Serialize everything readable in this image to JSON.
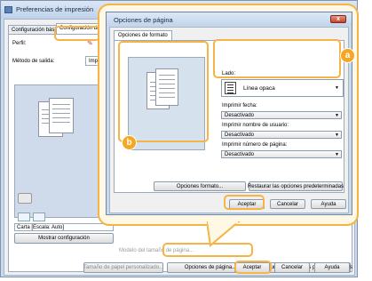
{
  "outer_window": {
    "title": "Preferencias de impresión",
    "tabs": [
      "Configuración básica",
      "Configuración de p"
    ],
    "profile_label": "Perfil:",
    "output_method_label": "Método de salida:",
    "output_method_value": "Imp",
    "paper_label": "Carta [Escala: Auto]",
    "show_config_button": "Mostrar configuración",
    "faded_row_left": "Tamaño de papel personalizado...",
    "faded_row_mid": "Modelo del tamaño de página...",
    "page_options_button": "Opciones de página...",
    "restore_button": "Restaurar las opciones predeterminadas",
    "ok_button": "Aceptar",
    "cancel_button": "Cancelar",
    "help_button": "Ayuda"
  },
  "dialog": {
    "title": "Opciones de página",
    "close_glyph": "x",
    "tab": "Opciones de formato",
    "lado_label": "Lado:",
    "lado_value": "Línea opaca",
    "print_date_label": "Imprimir fecha:",
    "print_date_value": "Desactivado",
    "print_user_label": "Imprimir nombre de usuario:",
    "print_user_value": "Desactivado",
    "print_page_label": "Imprimir número de página:",
    "print_page_value": "Desactivado",
    "format_options_button": "Opciones formato...",
    "restore_button": "Restaurar las opciones predeterminadas",
    "ok_button": "Aceptar",
    "cancel_button": "Cancelar",
    "help_button": "Ayuda"
  },
  "markers": {
    "a": "a",
    "b": "b"
  },
  "colors": {
    "highlight": "#f5b445",
    "marker": "#f5a623"
  },
  "icons": [
    "app-icon",
    "printer-icon",
    "close-icon",
    "chevron-down-icon",
    "watermark-line-icon"
  ]
}
